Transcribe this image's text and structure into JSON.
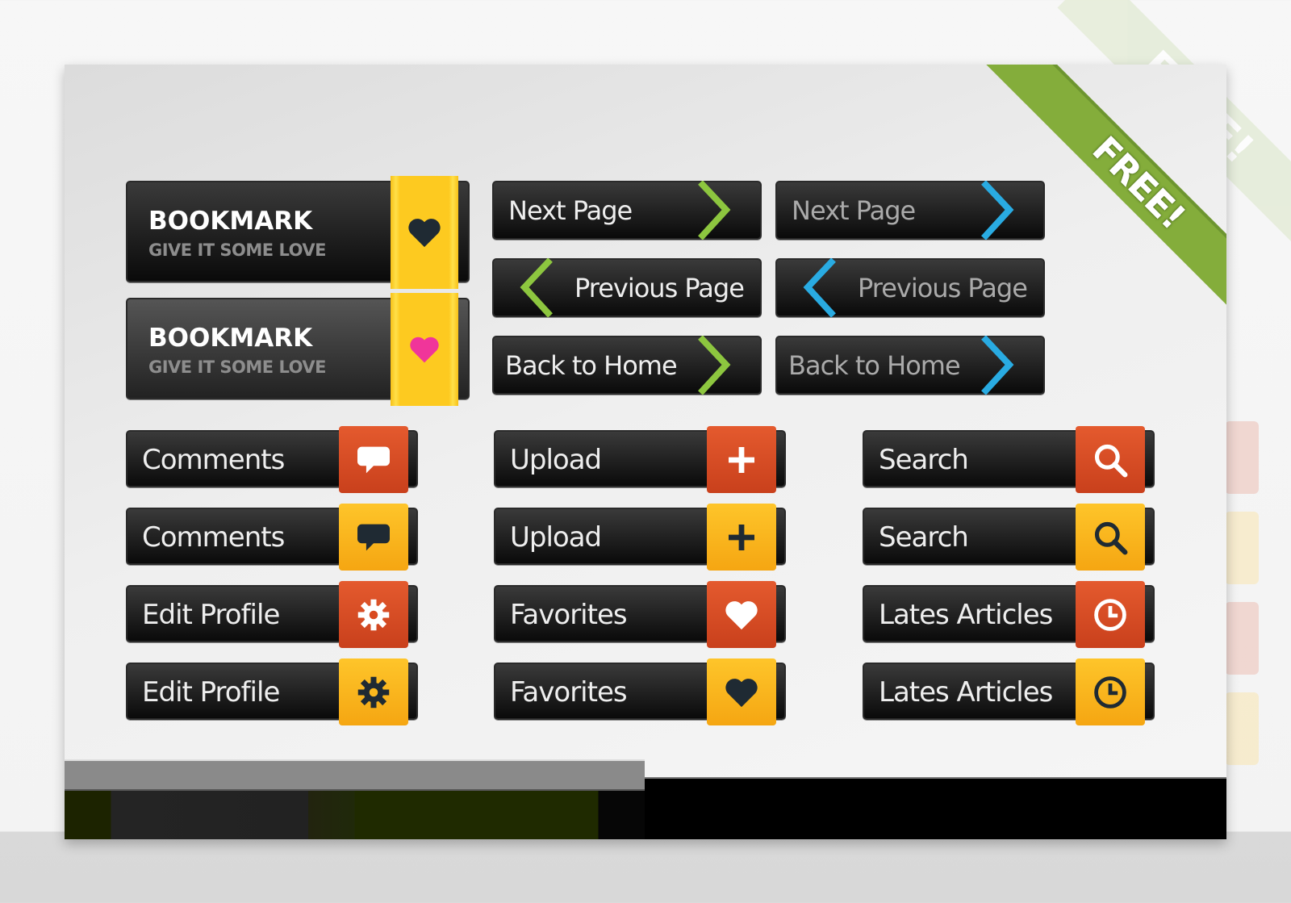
{
  "ribbon": {
    "label": "FREE!",
    "color": "#84ad3b"
  },
  "bookmarks": [
    {
      "title": "BOOKMARK",
      "subtitle": "GIVE IT SOME LOVE",
      "heart_color": "#1f2a33"
    },
    {
      "title": "BOOKMARK",
      "subtitle": "GIVE IT SOME LOVE",
      "heart_color": "#f0359a"
    }
  ],
  "nav_buttons": {
    "green": [
      {
        "label": "Next Page",
        "direction": "next"
      },
      {
        "label": "Previous Page",
        "direction": "prev"
      },
      {
        "label": "Back to Home",
        "direction": "next"
      }
    ],
    "blue": [
      {
        "label": "Next Page",
        "direction": "next"
      },
      {
        "label": "Previous Page",
        "direction": "prev"
      },
      {
        "label": "Back to Home",
        "direction": "next"
      }
    ],
    "accent_green": "#8dc63f",
    "accent_blue": "#29abe2"
  },
  "icon_buttons": [
    [
      {
        "label": "Comments",
        "icon": "speech-bubble-icon",
        "variant": "red"
      },
      {
        "label": "Comments",
        "icon": "speech-bubble-icon",
        "variant": "yellow"
      },
      {
        "label": "Edit Profile",
        "icon": "gear-icon",
        "variant": "red"
      },
      {
        "label": "Edit Profile",
        "icon": "gear-icon",
        "variant": "yellow"
      }
    ],
    [
      {
        "label": "Upload",
        "icon": "plus-icon",
        "variant": "red"
      },
      {
        "label": "Upload",
        "icon": "plus-icon",
        "variant": "yellow"
      },
      {
        "label": "Favorites",
        "icon": "heart-icon",
        "variant": "red"
      },
      {
        "label": "Favorites",
        "icon": "heart-icon",
        "variant": "yellow"
      }
    ],
    [
      {
        "label": "Search",
        "icon": "search-icon",
        "variant": "red"
      },
      {
        "label": "Search",
        "icon": "search-icon",
        "variant": "yellow"
      },
      {
        "label": "Lates Articles",
        "icon": "clock-icon",
        "variant": "red"
      },
      {
        "label": "Lates Articles",
        "icon": "clock-icon",
        "variant": "yellow"
      }
    ]
  ],
  "colors": {
    "red": "#d9491f",
    "yellow": "#fbb81e"
  }
}
